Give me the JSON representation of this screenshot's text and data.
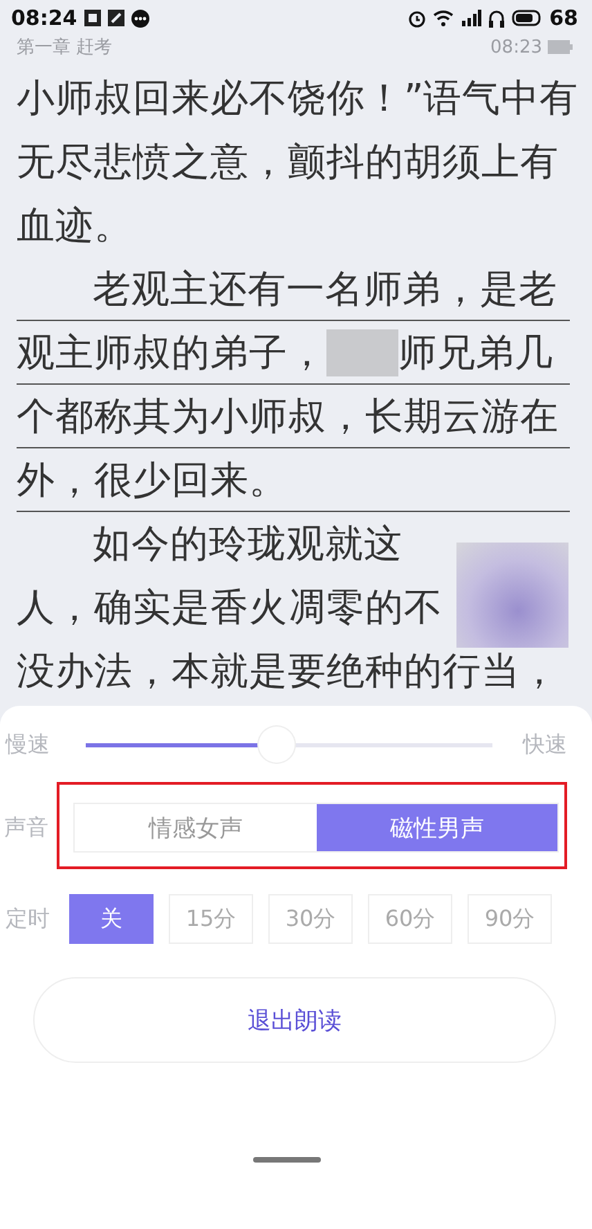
{
  "status_bar": {
    "time": "08:24",
    "battery": "68"
  },
  "header": {
    "chapter": "第一章 赶考",
    "time": "08:23"
  },
  "lines": [
    {
      "indented": false,
      "underlined": false,
      "segments": [
        {
          "kind": "text",
          "text": "小师叔回来必不饶你！”语气中有"
        }
      ]
    },
    {
      "indented": false,
      "underlined": false,
      "segments": [
        {
          "kind": "text",
          "text": "无尽悲愤之意，颤抖的胡须上有"
        }
      ]
    },
    {
      "indented": false,
      "underlined": false,
      "segments": [
        {
          "kind": "text",
          "text": "血迹。"
        }
      ]
    },
    {
      "indented": true,
      "underlined": true,
      "segments": [
        {
          "kind": "text",
          "text": "老观主还有一名师弟，是老"
        }
      ]
    },
    {
      "indented": false,
      "underlined": true,
      "segments": [
        {
          "kind": "text",
          "text": "观主师叔的弟子，"
        },
        {
          "kind": "blur"
        },
        {
          "kind": "text",
          "text": "师兄弟几"
        }
      ]
    },
    {
      "indented": false,
      "underlined": true,
      "segments": [
        {
          "kind": "text",
          "text": "个都称其为小师叔，长期云游在"
        }
      ]
    },
    {
      "indented": false,
      "underlined": true,
      "segments": [
        {
          "kind": "text",
          "text": "外，很少回来。"
        }
      ]
    },
    {
      "indented": true,
      "underlined": false,
      "segments": [
        {
          "kind": "text",
          "text": "如今的玲珑观就这"
        }
      ]
    },
    {
      "indented": false,
      "underlined": false,
      "segments": [
        {
          "kind": "text",
          "text": "人，确实是香火凋零的不"
        }
      ]
    },
    {
      "indented": false,
      "underlined": false,
      "segments": [
        {
          "kind": "text",
          "text": "没办法，本就是要绝种的行当，"
        }
      ]
    }
  ],
  "floating_widget": {
    "blurred": true
  },
  "tts_panel": {
    "speed": {
      "slow_label": "慢速",
      "fast_label": "快速",
      "level": 0.47
    },
    "voice": {
      "label": "声音",
      "highlighted": true,
      "options": [
        {
          "label": "情感女声",
          "selected": false
        },
        {
          "label": "磁性男声",
          "selected": true
        }
      ]
    },
    "timer": {
      "label": "定时",
      "options": [
        {
          "label": "关",
          "selected": true
        },
        {
          "label": "15分",
          "selected": false
        },
        {
          "label": "30分",
          "selected": false
        },
        {
          "label": "60分",
          "selected": false
        },
        {
          "label": "90分",
          "selected": false
        }
      ]
    },
    "exit_button": "退出朗读"
  }
}
